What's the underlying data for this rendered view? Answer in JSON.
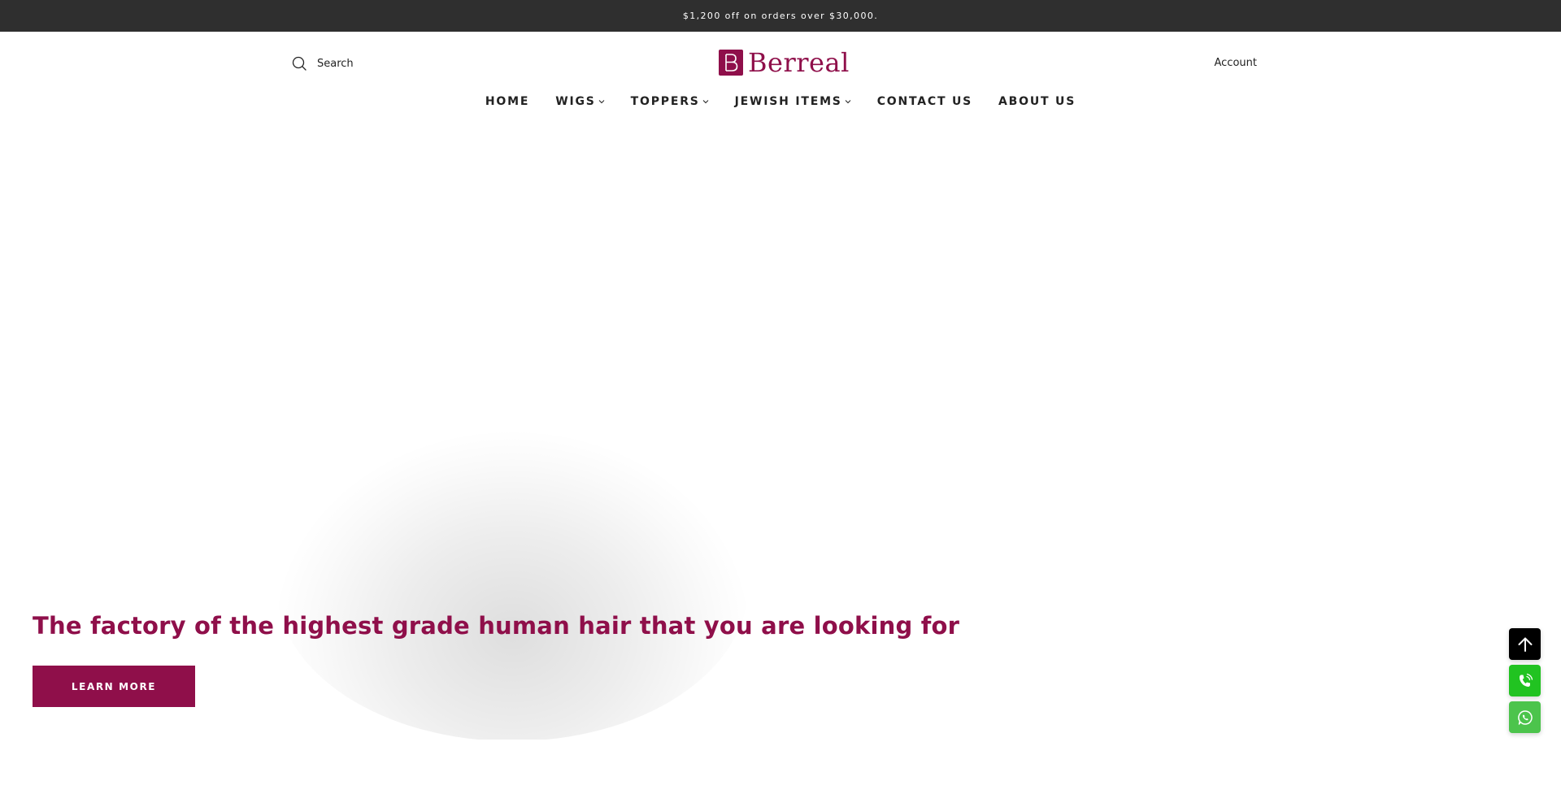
{
  "announcement": {
    "text": "$1,200 off on orders over $30,000."
  },
  "header": {
    "search_label": "Search",
    "logo_text": "Berreal",
    "account_label": "Account"
  },
  "nav": {
    "items": [
      {
        "label": "HOME",
        "has_dropdown": false
      },
      {
        "label": "WIGS",
        "has_dropdown": true
      },
      {
        "label": "TOPPERS",
        "has_dropdown": true
      },
      {
        "label": "JEWISH ITEMS",
        "has_dropdown": true
      },
      {
        "label": "CONTACT US",
        "has_dropdown": false
      },
      {
        "label": "ABOUT US",
        "has_dropdown": false
      }
    ]
  },
  "hero": {
    "title": "The factory of the highest grade human hair that you are looking for",
    "button_label": "LEARN MORE"
  },
  "floating_buttons": [
    {
      "name": "back-to-top",
      "icon": "arrow-up-icon"
    },
    {
      "name": "call",
      "icon": "phone-icon"
    },
    {
      "name": "whatsapp",
      "icon": "whatsapp-icon"
    }
  ],
  "colors": {
    "brand": "#8f0f4a",
    "announcement_bg": "#2f2f2f",
    "phone_green": "#21c321",
    "whatsapp_green": "#4cc44c"
  }
}
